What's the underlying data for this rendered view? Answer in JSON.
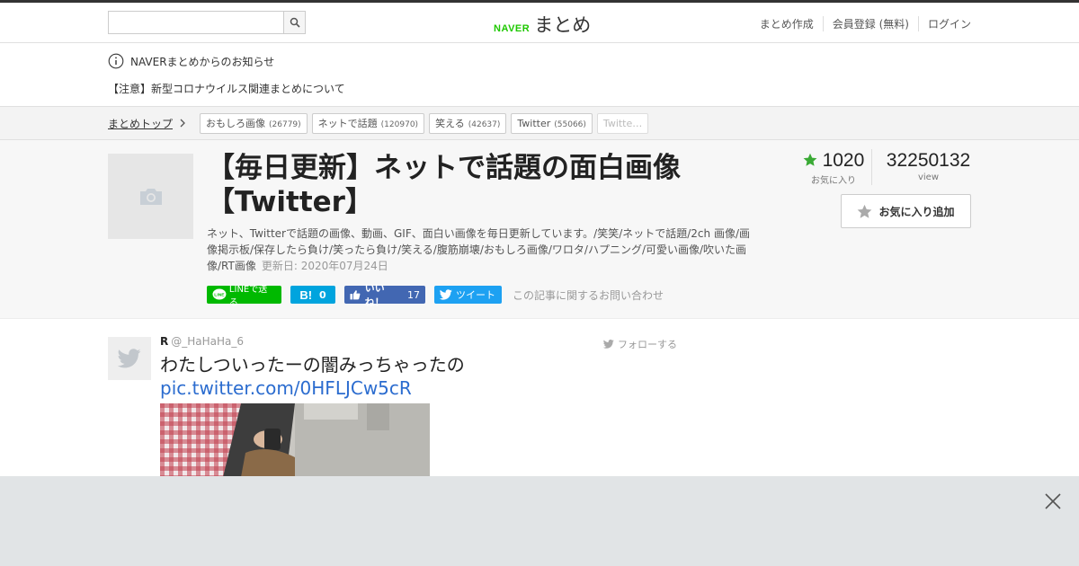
{
  "header": {
    "search_placeholder": "",
    "logo_naver": "NAVER",
    "logo_matome": "まとめ",
    "nav": [
      "まとめ作成",
      "会員登録 (無料)",
      "ログイン"
    ]
  },
  "notice": {
    "heading": "NAVERまとめからのお知らせ",
    "item": "【注意】新型コロナウイルス関連まとめについて"
  },
  "breadcrumb": {
    "top": "まとめトップ",
    "tags": [
      {
        "label": "おもしろ画像",
        "count": "(26779)"
      },
      {
        "label": "ネットで話題",
        "count": "(120970)"
      },
      {
        "label": "笑える",
        "count": "(42637)"
      },
      {
        "label": "Twitter",
        "count": "(55066)"
      },
      {
        "label": "Twitte…",
        "count": ""
      }
    ]
  },
  "article": {
    "title": "【毎日更新】ネットで話題の面白画像【Twitter】",
    "description": "ネット、Twitterで話題の画像、動画、GIF、面白い画像を毎日更新しています。/笑笑/ネットで話題/2ch 画像/画像掲示板/保存したら負け/笑ったら負け/笑える/腹筋崩壊/おもしろ画像/ワロタ/ハプニング/可愛い画像/吹いた画像/RT画像",
    "updated": "更新日: 2020年07月24日",
    "favorites": "1020",
    "favorites_label": "お気に入り",
    "views": "32250132",
    "views_label": "view",
    "fav_button": "お気に入り追加",
    "share": {
      "line": "LINEで送る",
      "hatena_count": "0",
      "fb_like": "いいね！",
      "fb_count": "17",
      "tweet": "ツイート"
    },
    "inquiry": "この記事に関するお問い合わせ"
  },
  "tweet": {
    "name": "R",
    "handle": "@_HaHaHa_6",
    "follow": "フォローする",
    "text": "わたしついったーの闇みっちゃったの",
    "link": "pic.twitter.com/0HFLJCw5cR"
  },
  "colors": {
    "naver_green": "#1ec800",
    "line_green": "#00b900",
    "hatena_blue": "#00a4de",
    "facebook_blue": "#4267b2",
    "twitter_blue": "#1da1f2",
    "link_blue": "#2b6ccf",
    "star_green": "#3aaa35"
  }
}
